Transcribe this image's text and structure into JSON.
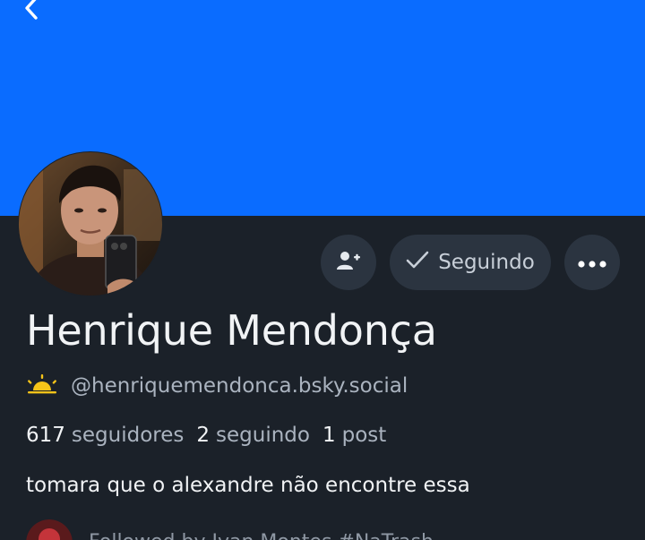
{
  "profile": {
    "display_name": "Henrique Mendonça",
    "handle": "@henriquemendonca.bsky.social",
    "bio": "tomara que o alexandre não encontre essa",
    "followed_by": "Followed by Ivan Montes #NaTrash"
  },
  "stats": {
    "followers_count": "617",
    "followers_label": "seguidores",
    "following_count": "2",
    "following_label": "seguindo",
    "posts_count": "1",
    "posts_label": "post"
  },
  "actions": {
    "following_label": "Seguindo"
  },
  "colors": {
    "banner": "#0a6cff",
    "background": "#1b2129",
    "button_bg": "#2b3440",
    "muted_text": "#aab3bf",
    "badge": "#f5c419"
  },
  "icons": {
    "back": "back-chevron-icon",
    "add_user": "add-user-icon",
    "check": "check-icon",
    "more": "more-dots-icon",
    "badge": "sunrise-badge-icon"
  }
}
